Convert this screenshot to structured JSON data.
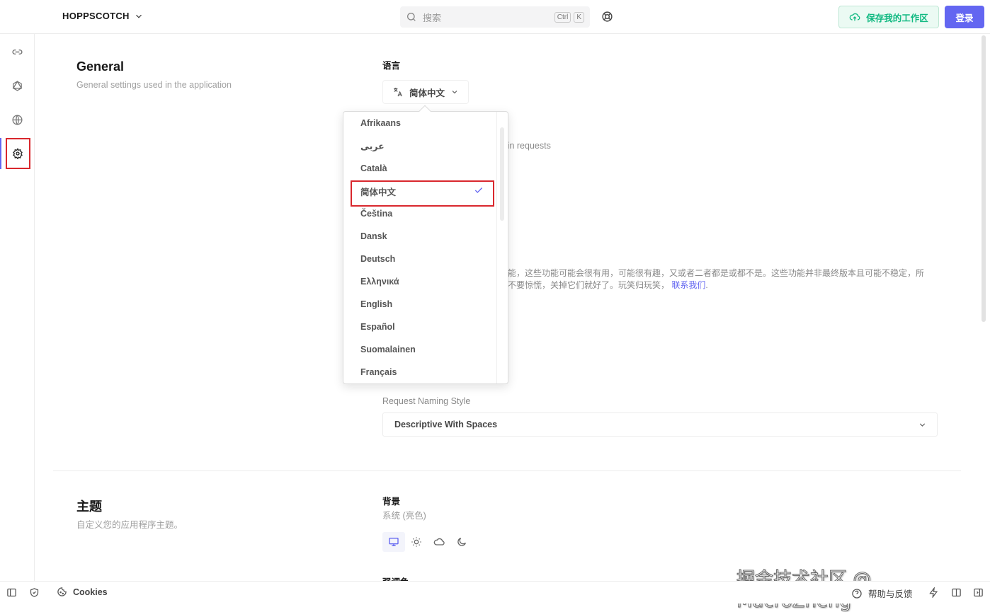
{
  "header": {
    "brand": "HOPPSCOTCH",
    "search_placeholder": "搜索",
    "kbd_ctrl": "Ctrl",
    "kbd_k": "K",
    "save_workspace": "保存我的工作区",
    "login": "登录"
  },
  "rail": {
    "items": [
      "rest-link-icon",
      "graphql-icon",
      "realtime-globe-icon",
      "settings-gear-icon"
    ],
    "active": "settings"
  },
  "general": {
    "title": "General",
    "description": "General settings used in the application",
    "language_label": "语言",
    "language_value": "简体中文",
    "query_params_fragment": "parameters in requests",
    "experiments_text": "功能，这些功能可能会很有用，可能很有趣，又或者二者都是或都不是。这些功能并非最终版本且可能不稳定，所",
    "experiments_text2": "，不要惊慌，关掉它们就好了。玩笑归玩笑，",
    "contact_link": "联系我们",
    "naming_label": "Request Naming Style",
    "naming_value": "Descriptive With Spaces"
  },
  "language_dropdown": {
    "items": [
      "Afrikaans",
      "عربى",
      "Català",
      "简体中文",
      "Čeština",
      "Dansk",
      "Deutsch",
      "Ελληνικά",
      "English",
      "Español",
      "Suomalainen",
      "Français"
    ],
    "selected": "简体中文"
  },
  "theme": {
    "title": "主题",
    "description": "自定义您的应用程序主题。",
    "background_label": "背景",
    "background_value": "系统 (亮色)",
    "options": [
      "system",
      "light",
      "cloud",
      "dark"
    ],
    "selected": "system",
    "accent_label": "强调色"
  },
  "footer": {
    "cookies": "Cookies",
    "help": "帮助与反馈"
  },
  "watermark": "掘金技术社区 @ MacroZheng",
  "colors": {
    "accent": "#6366f1",
    "save_green": "#10b981",
    "highlight": "#d9272d"
  }
}
